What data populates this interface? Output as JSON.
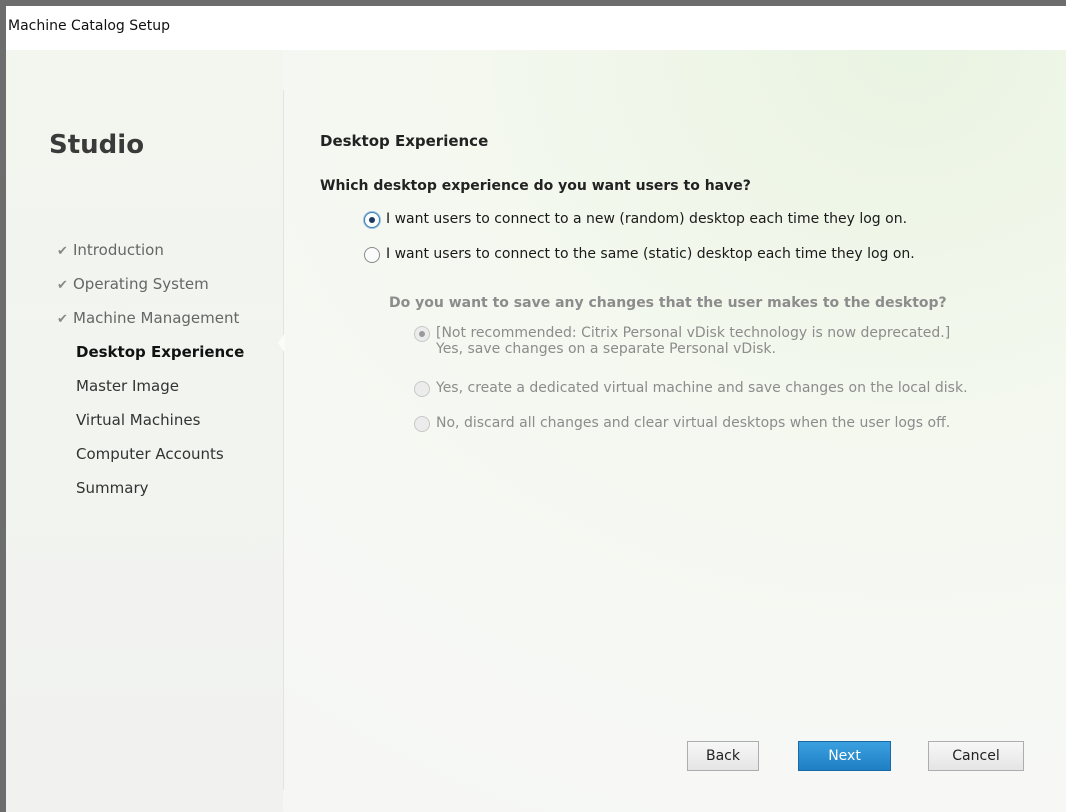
{
  "window": {
    "title": "Machine Catalog Setup"
  },
  "sidebar": {
    "brand": "Studio",
    "steps": [
      {
        "label": "Introduction",
        "state": "done"
      },
      {
        "label": "Operating System",
        "state": "done"
      },
      {
        "label": "Machine Management",
        "state": "done"
      },
      {
        "label": "Desktop Experience",
        "state": "active"
      },
      {
        "label": "Master Image",
        "state": "pending"
      },
      {
        "label": "Virtual Machines",
        "state": "pending"
      },
      {
        "label": "Computer Accounts",
        "state": "pending"
      },
      {
        "label": "Summary",
        "state": "pending"
      }
    ],
    "check_glyph": "✔"
  },
  "main": {
    "title": "Desktop Experience",
    "question": "Which desktop experience do you want users to have?",
    "options": [
      {
        "label": "I want users to connect to a new (random) desktop each time they log on.",
        "selected": true
      },
      {
        "label": "I want users to connect to the same (static) desktop each time they log on.",
        "selected": false
      }
    ],
    "sub_question": "Do you want to save any changes that the user makes to the desktop?",
    "sub_options": [
      {
        "label_line1": "[Not recommended: Citrix Personal vDisk technology is now deprecated.]",
        "label_line2": "Yes, save changes on a separate Personal vDisk.",
        "selected": true,
        "enabled": false
      },
      {
        "label_line1": "Yes, create a dedicated virtual machine and save changes on the local disk.",
        "selected": false,
        "enabled": false
      },
      {
        "label_line1": "No, discard all changes and clear virtual desktops when the user logs off.",
        "selected": false,
        "enabled": false
      }
    ]
  },
  "footer": {
    "back_label": "Back",
    "next_label": "Next",
    "cancel_label": "Cancel"
  },
  "colors": {
    "accent": "#1f7fc4",
    "disabled_text": "#8c8c8c"
  }
}
